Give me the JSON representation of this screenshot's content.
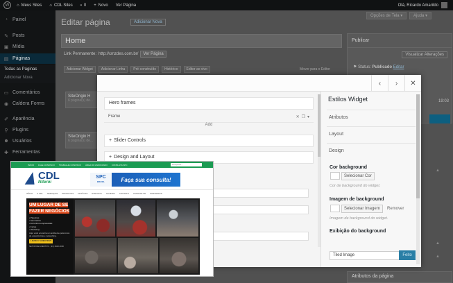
{
  "admin_bar": {
    "my_sites": "Meus Sites",
    "site_name": "CDL Sites",
    "comments_count": "0",
    "new_label": "Novo",
    "view_page": "Ver Página",
    "greeting": "Olá, Ricardo Amarildo"
  },
  "sidebar": {
    "items": [
      {
        "label": "Painel",
        "icon": "dashboard-icon"
      },
      {
        "label": "Posts",
        "icon": "pin-icon"
      },
      {
        "label": "Mídia",
        "icon": "media-icon"
      },
      {
        "label": "Páginas",
        "icon": "pages-icon"
      },
      {
        "label": "Comentários",
        "icon": "comment-icon"
      },
      {
        "label": "Caldera Forms",
        "icon": "form-icon"
      },
      {
        "label": "Aparência",
        "icon": "brush-icon"
      },
      {
        "label": "Plugins",
        "icon": "plugin-icon"
      },
      {
        "label": "Usuários",
        "icon": "users-icon"
      },
      {
        "label": "Ferramentas",
        "icon": "tools-icon"
      }
    ],
    "sub_items": [
      "Todas as Páginas",
      "Adicionar Nova"
    ]
  },
  "page": {
    "heading": "Editar página",
    "add_new": "Adicionar Nova",
    "screen_options": "Opções de Tela",
    "help": "Ajuda",
    "title_value": "Home",
    "permalink_label": "Link Permanente:",
    "permalink_url": "http://cmzdes.com.br/",
    "permalink_button": "Ver Página",
    "editor_buttons": [
      "Adicionar Widget",
      "Adicionar Linha",
      "Pré-construído",
      "Histórico",
      "Editor ao vivo"
    ],
    "editor_right": "Mover para o Editor",
    "rows": [
      {
        "title": "SiteOrigin H",
        "sub": "6 página(s) de..."
      },
      {
        "title": "SiteOrigin H",
        "sub": "6 página(s) de..."
      }
    ]
  },
  "publish": {
    "title": "Publicar",
    "preview": "Visualizar Alterações",
    "status_label": "Status:",
    "status_value": "Publicado",
    "status_edit": "Editar",
    "time": "19:03"
  },
  "attributes_box": {
    "title": "Atributos da página"
  },
  "modal": {
    "sections": {
      "hero": "Hero frames",
      "frame": "Frame",
      "add": "Add",
      "slider": "Slider Controls",
      "design": "Design and Layout"
    },
    "sidebar": {
      "title": "Estilos Widget",
      "tabs": [
        "Atributos",
        "Layout",
        "Design"
      ],
      "bg_color_label": "Cor background",
      "bg_color_button": "Selecionar Cor",
      "bg_color_hint": "Cor de background do widget.",
      "bg_image_label": "Imagem de background",
      "bg_image_button": "Selecionar Imagem",
      "bg_image_remove": "Remover",
      "bg_image_hint": "Imagem de background do widget.",
      "bg_display_label": "Exibição do background",
      "bg_display_value": "Tiled Image"
    },
    "done": "Feito"
  },
  "website_preview": {
    "top_links": [
      "INÍCIO",
      "FALE CONOSCO",
      "TRABALHE CONOSCO",
      "ÁREA DO ASSOCIADO",
      "CONSULTA SPC"
    ],
    "search_placeholder": "Pesquisar...",
    "logo_text": "CDL",
    "logo_city": "Niterói",
    "spc_brand": "SPC",
    "spc_sub": "BRASIL",
    "spc_cta": "Faça sua consulta!",
    "menu": [
      "INÍCIO",
      "A CDL",
      "SERVIÇOS",
      "PRODUTOS",
      "NOTÍCIAS",
      "EVENTOS",
      "GALERIA",
      "CONTATO",
      "ASSOCIE-SE",
      "PARCEIROS"
    ],
    "hero_headline": "UM LUGAR DE SE FAZER NEGÓCIOS",
    "hero_items": [
      "Palestras",
      "Seminários",
      "Encontros empresariais",
      "Feiras",
      "Workshop"
    ],
    "hero_text": "Aqui você encontra um ambiente para troca de experiências e networking.",
    "hero_badge": "LIGUE E SAIBA MAIS",
    "hero_footer": "SETOR DE EVENTOS · (21) 2620-0000",
    "accent": "#1b9b52",
    "brand_blue": "#1d4a8c"
  }
}
